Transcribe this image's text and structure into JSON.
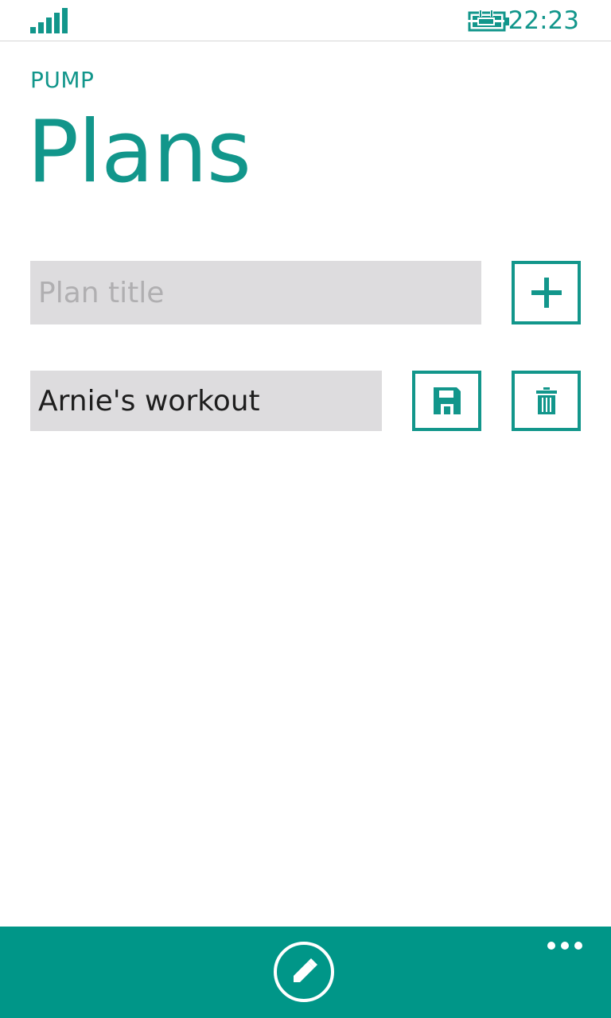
{
  "status_bar": {
    "time": "22:23",
    "signal_icon": "signal-strength-icon",
    "battery_icon": "battery-charging-icon"
  },
  "app": {
    "name": "PUMP"
  },
  "page": {
    "title": "Plans"
  },
  "new_plan": {
    "placeholder": "Plan title",
    "value": "",
    "add_icon": "plus-icon"
  },
  "plans": [
    {
      "title": "Arnie's workout",
      "save_icon": "save-icon",
      "delete_icon": "trash-icon"
    }
  ],
  "app_bar": {
    "edit_icon": "pencil-icon",
    "more_icon": "more-icon"
  },
  "colors": {
    "accent": "#12968b",
    "app_bar": "#009688",
    "field_background": "#dddcde",
    "placeholder_text": "#b0afb1"
  }
}
